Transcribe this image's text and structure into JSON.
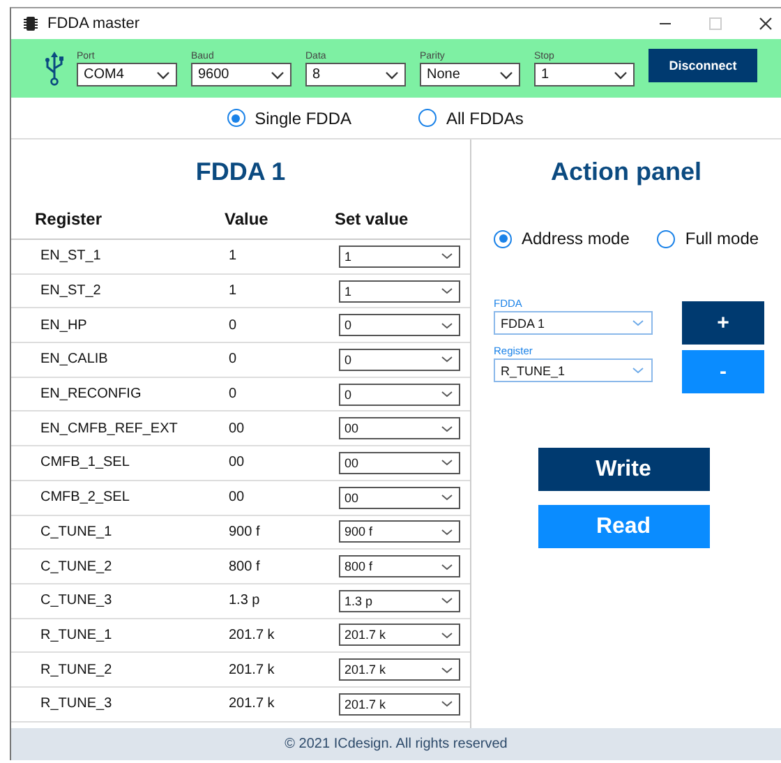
{
  "window": {
    "title": "FDDA master"
  },
  "connection": {
    "fields": [
      {
        "label": "Port",
        "value": "COM4"
      },
      {
        "label": "Baud",
        "value": "9600"
      },
      {
        "label": "Data",
        "value": "8"
      },
      {
        "label": "Parity",
        "value": "None"
      },
      {
        "label": "Stop",
        "value": "1"
      }
    ],
    "button": "Disconnect"
  },
  "view_mode": [
    {
      "label": "Single FDDA",
      "selected": true
    },
    {
      "label": "All FDDAs",
      "selected": false
    }
  ],
  "fdda_panel": {
    "title": "FDDA 1",
    "columns": [
      "Register",
      "Value",
      "Set value"
    ],
    "rows": [
      {
        "register": "EN_ST_1",
        "value": "1",
        "set_value": "1"
      },
      {
        "register": "EN_ST_2",
        "value": "1",
        "set_value": "1"
      },
      {
        "register": "EN_HP",
        "value": "0",
        "set_value": "0"
      },
      {
        "register": "EN_CALIB",
        "value": "0",
        "set_value": "0"
      },
      {
        "register": "EN_RECONFIG",
        "value": "0",
        "set_value": "0"
      },
      {
        "register": "EN_CMFB_REF_EXT",
        "value": "00",
        "set_value": "00"
      },
      {
        "register": "CMFB_1_SEL",
        "value": "00",
        "set_value": "00"
      },
      {
        "register": "CMFB_2_SEL",
        "value": "00",
        "set_value": "00"
      },
      {
        "register": "C_TUNE_1",
        "value": "900 f",
        "set_value": "900 f"
      },
      {
        "register": "C_TUNE_2",
        "value": "800 f",
        "set_value": "800 f"
      },
      {
        "register": "C_TUNE_3",
        "value": "1.3 p",
        "set_value": "1.3 p"
      },
      {
        "register": "R_TUNE_1",
        "value": "201.7 k",
        "set_value": "201.7 k"
      },
      {
        "register": "R_TUNE_2",
        "value": "201.7 k",
        "set_value": "201.7 k"
      },
      {
        "register": "R_TUNE_3",
        "value": "201.7 k",
        "set_value": "201.7 k"
      }
    ]
  },
  "action_panel": {
    "title": "Action panel",
    "modes": [
      {
        "label": "Address mode",
        "selected": true
      },
      {
        "label": "Full mode",
        "selected": false
      }
    ],
    "fields": [
      {
        "label": "FDDA",
        "value": "FDDA 1"
      },
      {
        "label": "Register",
        "value": "R_TUNE_1"
      }
    ],
    "step_buttons": [
      "+",
      "-"
    ],
    "buttons": [
      "Write",
      "Read"
    ]
  },
  "footer": "© 2021 ICdesign. All rights reserved"
}
